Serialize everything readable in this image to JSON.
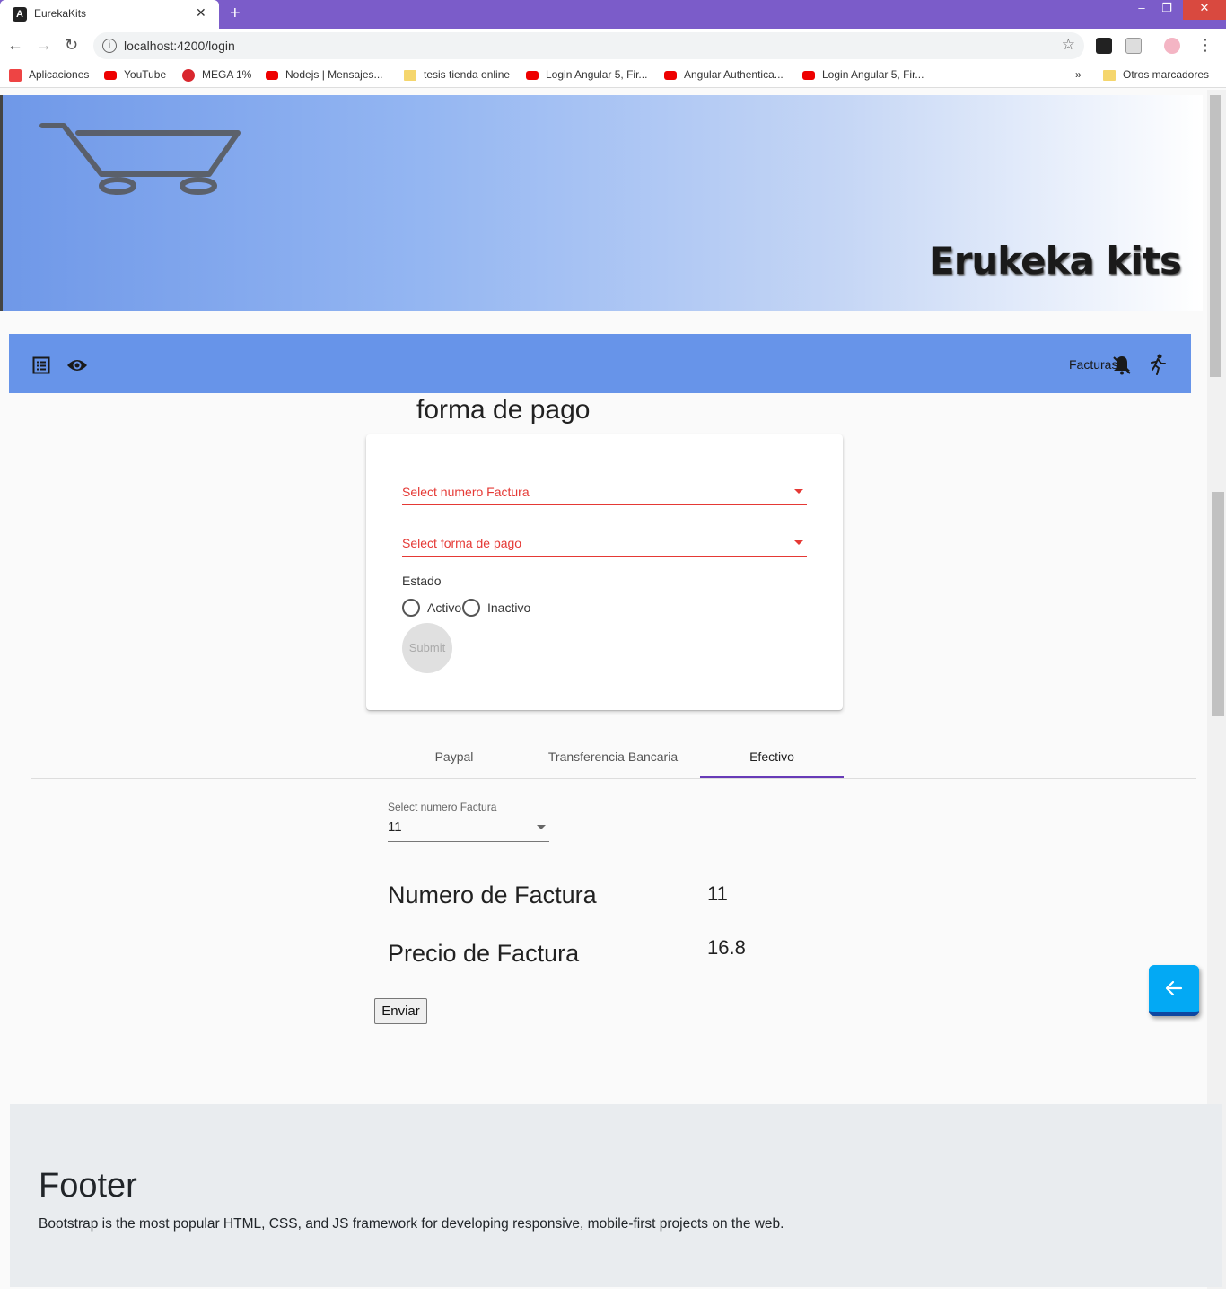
{
  "browser": {
    "tab_title": "EurekaKits",
    "favicon_letter": "A",
    "url": "localhost:4200/login",
    "bookmarks": [
      {
        "label": "Aplicaciones",
        "icon": "apps-grid-icon"
      },
      {
        "label": "YouTube",
        "icon": "youtube-icon"
      },
      {
        "label": "MEGA 1%",
        "icon": "mega-icon"
      },
      {
        "label": "Nodejs | Mensajes...",
        "icon": "youtube-icon"
      },
      {
        "label": "tesis tienda online",
        "icon": "folder-icon"
      },
      {
        "label": "Login Angular 5, Fir...",
        "icon": "youtube-icon"
      },
      {
        "label": "Angular Authentica...",
        "icon": "youtube-icon"
      },
      {
        "label": "Login Angular 5, Fir...",
        "icon": "youtube-icon"
      }
    ],
    "overflow": "»",
    "other_bookmarks": "Otros marcadores"
  },
  "header": {
    "brand": "Erukeka kits"
  },
  "toolbar": {
    "facturas_label": "Facturas"
  },
  "main": {
    "title": "forma de pago",
    "form": {
      "select_factura_placeholder": "Select numero Factura",
      "select_pago_placeholder": "Select forma de pago",
      "estado_label": "Estado",
      "radio_activo": "Activo",
      "radio_inactivo": "Inactivo",
      "submit_label": "Submit"
    },
    "tabs": [
      {
        "label": "Paypal",
        "active": false
      },
      {
        "label": "Transferencia Bancaria",
        "active": false
      },
      {
        "label": "Efectivo",
        "active": true
      }
    ],
    "efectivo": {
      "select_label": "Select numero Factura",
      "select_value": "11",
      "numero_label": "Numero de Factura",
      "numero_value": "11",
      "precio_label": "Precio de Factura",
      "precio_value": "16.8",
      "enviar_label": "Enviar"
    }
  },
  "footer": {
    "title": "Footer",
    "text": "Bootstrap is the most popular HTML, CSS, and JS framework for developing responsive, mobile-first projects on the web."
  },
  "colors": {
    "toolbar": "#6794e9",
    "tab_bar": "#7b5cc9",
    "error": "#e53935",
    "tab_indicator": "#673ab7",
    "fab": "#03a9f4"
  }
}
